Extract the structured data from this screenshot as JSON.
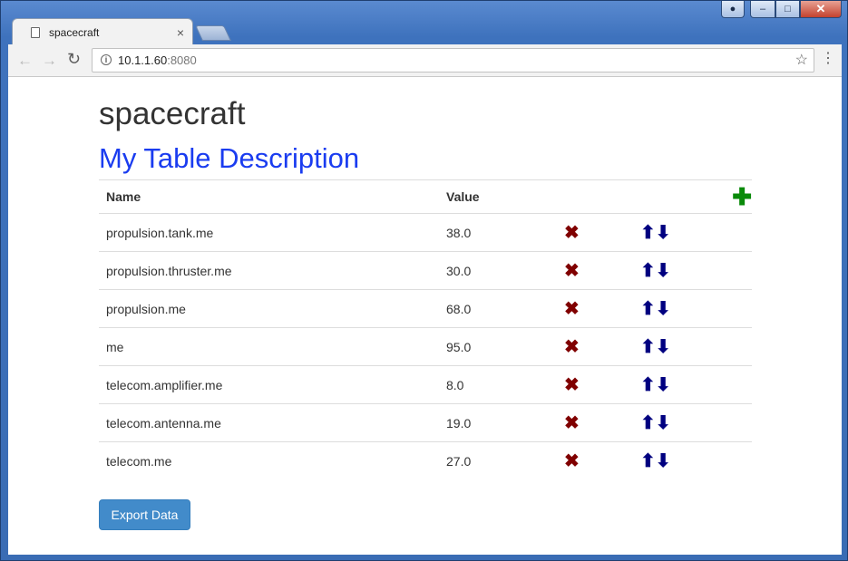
{
  "browser": {
    "tab_title": "spacecraft",
    "tab_close": "×",
    "url_host": "10.1.1.60",
    "url_port": ":8080",
    "window_controls": {
      "minimize": "–",
      "maximize": "□",
      "close": "✕"
    }
  },
  "page": {
    "app_title": "spacecraft",
    "table_title": "My Table Description",
    "columns": {
      "name": "Name",
      "value": "Value"
    },
    "rows": [
      {
        "name": "propulsion.tank.me",
        "value": "38.0"
      },
      {
        "name": "propulsion.thruster.me",
        "value": "30.0"
      },
      {
        "name": "propulsion.me",
        "value": "68.0"
      },
      {
        "name": "me",
        "value": "95.0"
      },
      {
        "name": "telecom.amplifier.me",
        "value": "8.0"
      },
      {
        "name": "telecom.antenna.me",
        "value": "19.0"
      },
      {
        "name": "telecom.me",
        "value": "27.0"
      }
    ],
    "export_label": "Export Data"
  },
  "icons": {
    "add": "plus-icon",
    "delete": "x-icon",
    "move_up": "arrow-up-icon",
    "move_down": "arrow-down-icon"
  },
  "colors": {
    "table_title": "#1a3cf0",
    "delete_icon": "#800000",
    "arrow_icon": "#000080",
    "add_icon": "#0a8a0a",
    "export_button": "#428bca"
  }
}
